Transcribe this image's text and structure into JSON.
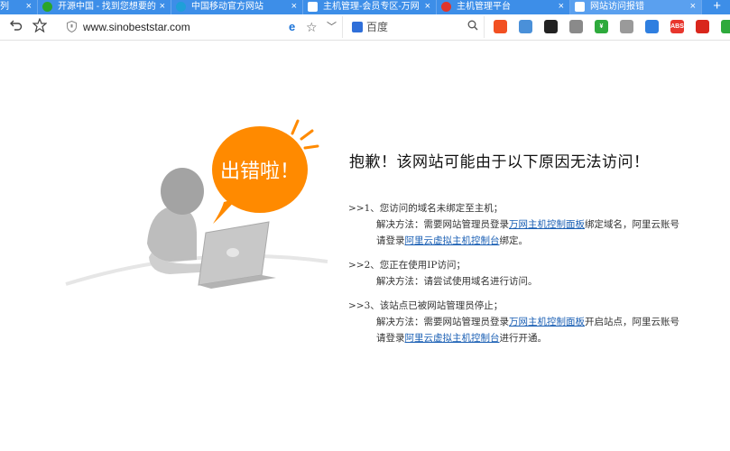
{
  "browser": {
    "tabs": [
      {
        "label": "列",
        "icon_color": "#ffffff",
        "active": false
      },
      {
        "label": "开源中国 - 找到您想要的",
        "icon_color": "#2aa52a",
        "active": false
      },
      {
        "label": "中国移动官方网站",
        "icon_color": "#1f9fd8",
        "active": false
      },
      {
        "label": "主机管理-会员专区-万网",
        "icon_color": "#ff7a00",
        "active": false
      },
      {
        "label": "主机管理平台",
        "icon_color": "#e0352b",
        "active": false
      },
      {
        "label": "网站访问报错",
        "icon_color": "#6a5acd",
        "active": true
      }
    ],
    "close_glyph": "×",
    "new_tab_glyph": "+",
    "url": "www.sinobeststar.com",
    "search_engine_label": "百度",
    "extensions": [
      {
        "name": "grid-extension-icon",
        "color": "#f25022",
        "text": ""
      },
      {
        "name": "minus-circle-extension-icon",
        "color": "#4a90d9",
        "text": ""
      },
      {
        "name": "settings-extension-icon",
        "color": "#222222",
        "text": ""
      },
      {
        "name": "player-extension-icon",
        "color": "#8a8a8a",
        "text": ""
      },
      {
        "name": "yuan-extension-icon",
        "color": "#2eaa3c",
        "text": "¥"
      },
      {
        "name": "triangle-extension-icon",
        "color": "#9a9a9a",
        "text": ""
      },
      {
        "name": "shield-extension-icon",
        "color": "#2f7fe0",
        "text": ""
      },
      {
        "name": "adblock-extension-icon",
        "color": "#e8362d",
        "text": "ABS"
      },
      {
        "name": "flag-extension-icon",
        "color": "#d9261c",
        "text": ""
      },
      {
        "name": "tv-extension-icon",
        "color": "#2eaa3c",
        "text": ""
      }
    ]
  },
  "page": {
    "badge_text": "出错啦！",
    "title": "抱歉！该网站可能由于以下原因无法访问！",
    "reasons": [
      {
        "head": ">>1、您访问的域名未绑定至主机；",
        "line1": {
          "pre": "解决方法：需要网站管理员登录",
          "link": "万网主机控制面板",
          "post": "绑定域名，阿里云账号"
        },
        "line2": {
          "pre": "请登录",
          "link": "阿里云虚拟主机控制台",
          "post": "绑定。"
        }
      },
      {
        "head": ">>2、您正在使用IP访问；",
        "line1": {
          "pre": "解决方法：请尝试使用域名进行访问。",
          "link": "",
          "post": ""
        }
      },
      {
        "head": ">>3、该站点已被网站管理员停止；",
        "line1": {
          "pre": "解决方法：需要网站管理员登录",
          "link": "万网主机控制面板",
          "post": "开启站点，阿里云账号"
        },
        "line2": {
          "pre": "请登录",
          "link": "阿里云虚拟主机控制台",
          "post": "进行开通。"
        }
      }
    ]
  },
  "colors": {
    "tab_bar": "#3d8ee8",
    "badge": "#ff8a00",
    "link": "#1a5fb4"
  }
}
